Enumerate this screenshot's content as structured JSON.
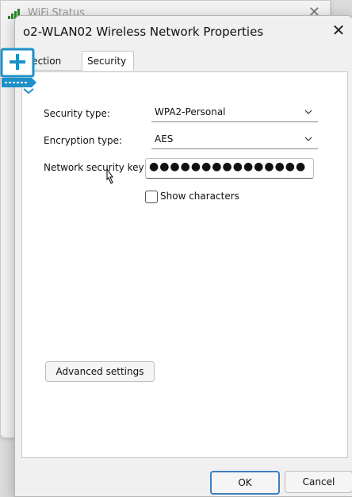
{
  "background_window": {
    "title": "WiFi Status",
    "close": "✕"
  },
  "dialog": {
    "title": "o2-WLAN02 Wireless Network Properties",
    "close": "✕"
  },
  "tabs": [
    {
      "label": "nnection"
    },
    {
      "label": "Security"
    }
  ],
  "security": {
    "security_type_label": "Security type:",
    "security_type_value": "WPA2-Personal",
    "encryption_type_label": "Encryption type:",
    "encryption_type_value": "AES",
    "network_key_label": "Network security key",
    "network_key_value": "●●●●●●●●●●●●●●●",
    "show_characters_label": "Show characters",
    "show_characters_checked": false
  },
  "buttons": {
    "advanced": "Advanced settings",
    "ok": "OK",
    "cancel": "Cancel"
  },
  "colors": {
    "accent": "#3d7fc1",
    "logo": "#1e90c8",
    "signal": "#2d8a2d"
  }
}
